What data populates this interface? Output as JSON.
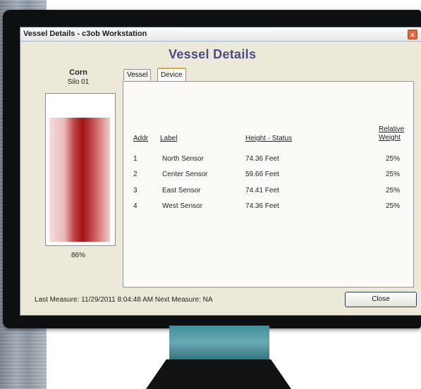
{
  "window": {
    "title": "Vessel Details - c3ob Workstation",
    "close_symbol": "x"
  },
  "heading": "Vessel Details",
  "silo": {
    "name": "Corn",
    "sub": "Silo 01",
    "level_label": "86%",
    "level": 0.86
  },
  "tabs": [
    {
      "label": "Vessel"
    },
    {
      "label": "Device",
      "selected": true
    }
  ],
  "table": {
    "headers": {
      "addr": "Addr",
      "label": "Label",
      "height": "Height - Status",
      "weight_line1": "Relative",
      "weight_line2": "Weight"
    },
    "rows": [
      {
        "addr": "1",
        "label": "North Sensor",
        "height": "74.36 Feet",
        "weight": "25%"
      },
      {
        "addr": "2",
        "label": "Center Sensor",
        "height": "59.66 Feet",
        "weight": "25%"
      },
      {
        "addr": "3",
        "label": "East Sensor",
        "height": "74.41 Feet",
        "weight": "25%"
      },
      {
        "addr": "4",
        "label": "West Sensor",
        "height": "74.36 Feet",
        "weight": "25%"
      }
    ]
  },
  "footer": {
    "status": "Last Measure: 11/29/2011 8:04:48 AM    Next Measure: NA",
    "close_label": "Close"
  },
  "colors": {
    "fill_dark": "#9e1414",
    "heading": "#4a4a8a",
    "tab_accent": "#f0a23a",
    "stand": "#3f8f9c"
  }
}
